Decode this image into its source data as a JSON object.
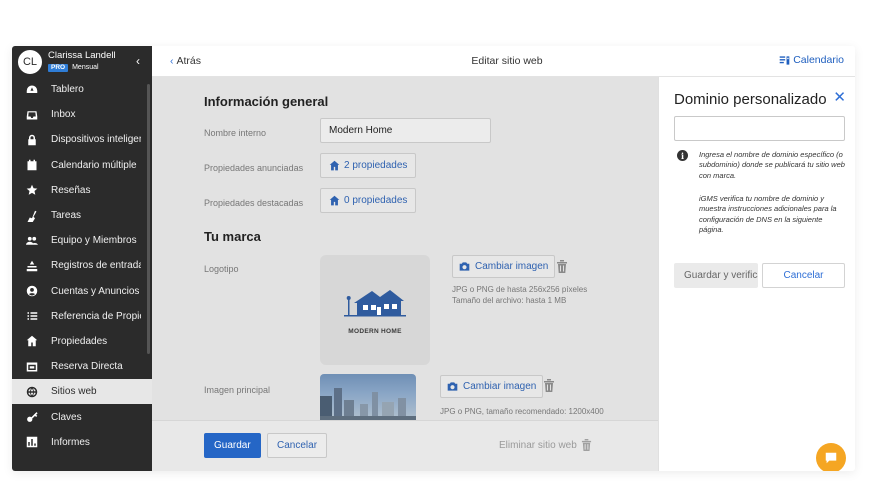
{
  "user": {
    "initials": "CL",
    "name": "Clarissa Landell",
    "badge": "PRO",
    "plan": "Mensual"
  },
  "sidebar": {
    "items": [
      {
        "label": "Tablero",
        "icon": "dashboard-icon"
      },
      {
        "label": "Inbox",
        "icon": "inbox-icon"
      },
      {
        "label": "Dispositivos inteligentes",
        "icon": "lock-icon"
      },
      {
        "label": "Calendario múltiple",
        "icon": "calendar-icon"
      },
      {
        "label": "Reseñas",
        "icon": "star-icon"
      },
      {
        "label": "Tareas",
        "icon": "broom-icon"
      },
      {
        "label": "Equipo y Miembros",
        "icon": "team-icon"
      },
      {
        "label": "Registros de entrada",
        "icon": "checkin-icon"
      },
      {
        "label": "Cuentas y Anuncios",
        "icon": "accounts-icon"
      },
      {
        "label": "Referencia de Propiedades",
        "icon": "list-icon"
      },
      {
        "label": "Propiedades",
        "icon": "home-icon"
      },
      {
        "label": "Reserva Directa",
        "icon": "booking-icon"
      },
      {
        "label": "Sitios web",
        "icon": "globe-icon",
        "active": true
      },
      {
        "label": "Claves",
        "icon": "key-icon"
      },
      {
        "label": "Informes",
        "icon": "reports-icon"
      }
    ]
  },
  "topbar": {
    "back": "Atrás",
    "title": "Editar sitio web",
    "calendar": "Calendario"
  },
  "main": {
    "general_title": "Información general",
    "internal_name_label": "Nombre interno",
    "internal_name_value": "Modern Home",
    "listed_label": "Propiedades anunciadas",
    "listed_value": "2 propiedades",
    "featured_label": "Propiedades destacadas",
    "featured_value": "0 propiedades",
    "brand_title": "Tu marca",
    "logo_label": "Logotipo",
    "logo_text": "MODERN HOME",
    "change_image": "Cambiar imagen",
    "logo_hint_1": "JPG o PNG de hasta 256x256 píxeles",
    "logo_hint_2": "Tamaño del archivo: hasta 1 MB",
    "main_image_label": "Imagen principal",
    "main_image_hint": "JPG o PNG, tamaño recomendado: 1200x400"
  },
  "bottombar": {
    "save": "Guardar",
    "cancel": "Cancelar",
    "delete": "Eliminar sitio web"
  },
  "panel": {
    "title": "Dominio personalizado",
    "domain_value": "",
    "info_1": "Ingresa el nombre de dominio específico (o subdominio) donde se publicará tu sitio web con marca.",
    "info_2": "iGMS verifica tu nombre de dominio y muestra instrucciones adicionales para la configuración de DNS en la siguiente página.",
    "save_verify": "Guardar y verificar",
    "cancel": "Cancelar"
  },
  "colors": {
    "sidebar_bg": "#2b2b2b",
    "accent": "#2566c6",
    "chat": "#f5a623"
  }
}
